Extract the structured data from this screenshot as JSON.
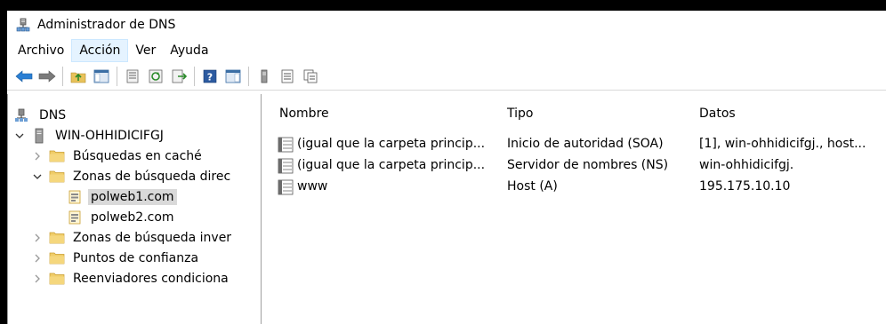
{
  "window": {
    "title": "Administrador de DNS"
  },
  "menu": [
    "Archivo",
    "Acción",
    "Ver",
    "Ayuda"
  ],
  "tree": {
    "root": "DNS",
    "server": "WIN-OHHIDICIFGJ",
    "items": [
      {
        "label": "Búsquedas en caché"
      },
      {
        "label": "Zonas de búsqueda direc"
      },
      {
        "label": "polweb1.com"
      },
      {
        "label": "polweb2.com"
      },
      {
        "label": "Zonas de búsqueda inver"
      },
      {
        "label": "Puntos de confianza"
      },
      {
        "label": "Reenviadores condiciona"
      }
    ]
  },
  "list": {
    "headers": {
      "nombre": "Nombre",
      "tipo": "Tipo",
      "datos": "Datos"
    },
    "rows": [
      {
        "nombre": "(igual que la carpeta princip...",
        "tipo": "Inicio de autoridad (SOA)",
        "datos": "[1], win-ohhidicifgj., host..."
      },
      {
        "nombre": "(igual que la carpeta princip...",
        "tipo": "Servidor de nombres (NS)",
        "datos": "win-ohhidicifgj."
      },
      {
        "nombre": "www",
        "tipo": "Host (A)",
        "datos": "195.175.10.10"
      }
    ]
  }
}
